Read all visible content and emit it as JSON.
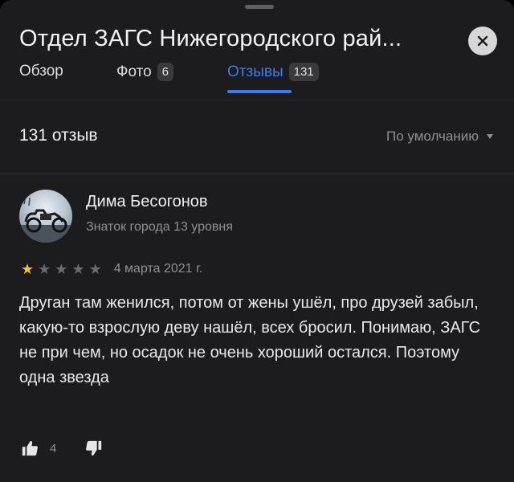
{
  "header": {
    "title": "Отдел ЗАГС Нижегородского рай...",
    "close_icon": "close-icon"
  },
  "tabs": [
    {
      "label": "Обзор",
      "count": null,
      "active": false
    },
    {
      "label": "Фото",
      "count": "6",
      "active": false
    },
    {
      "label": "Отзывы",
      "count": "131",
      "active": true
    }
  ],
  "reviews_header": {
    "count_label": "131 отзыв",
    "sort_label": "По умолчанию"
  },
  "review": {
    "author": "Дима Бесогонов",
    "level": "Знаток города 13 уровня",
    "rating": 1,
    "max_rating": 5,
    "date": "4 марта 2021 г.",
    "text": "Друган там женился, потом от жены ушёл, про друзей забыл, какую-то взрослую деву нашёл, всех бросил. Понимаю, ЗАГС не при чем, но осадок не очень хороший остался. Поэтому одна звезда",
    "likes": "4"
  },
  "colors": {
    "background": "#1c1c1e",
    "accent": "#3d7cf0",
    "star": "#ffc21a",
    "muted": "#8f8f93"
  }
}
